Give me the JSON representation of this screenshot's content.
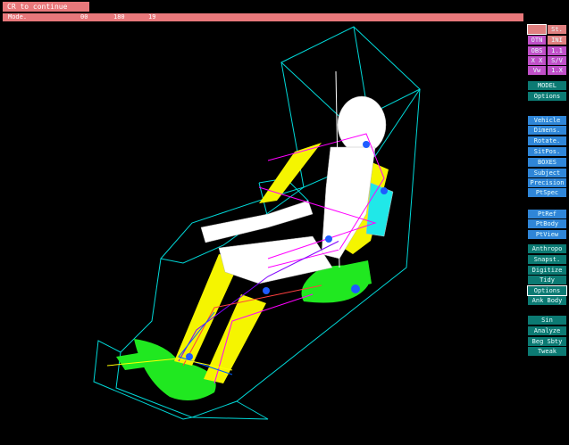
{
  "top_button": "CR to continue",
  "status": {
    "mode": "Mode.",
    "v1": "00",
    "v2": "180",
    "v3": "19"
  },
  "panel": {
    "r0": [
      "",
      "St."
    ],
    "r1": [
      "OTN",
      "INI"
    ],
    "r2": [
      "OBS",
      "1.1"
    ],
    "r3": [
      "X X",
      "S/V"
    ],
    "r4": [
      "Vw",
      "1.X"
    ],
    "model": "MODEL",
    "options": "Options",
    "blue": [
      "Vehicle",
      "Dimens.",
      "Rotate.",
      "SitPos.",
      "BOXES",
      "Subject",
      "Precision",
      "PtSpec",
      "PtRef",
      "PtBody",
      "PtView"
    ],
    "teal": [
      "Anthropo",
      "Snapst.",
      "Digitize",
      "Tidy",
      "Options",
      "Ank Body",
      "Sin",
      "Analyze",
      "Beg Sbty",
      "Tweak"
    ]
  },
  "colors": {
    "status_bar": "#e8787b",
    "button_teal": "#0c7a73",
    "button_blue": "#2f86d8",
    "wireframe": "#00d8d8",
    "body_yellow": "#f5f500",
    "seat_green": "#20e820"
  }
}
